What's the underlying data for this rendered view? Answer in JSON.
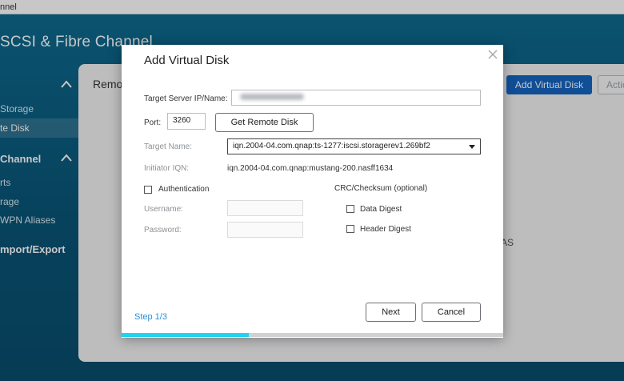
{
  "window": {
    "title_fragment": "nnel"
  },
  "app": {
    "title_fragment": "SCSI & Fibre Channel"
  },
  "sidebar": {
    "groups": [
      {
        "label": "",
        "top": 0
      },
      {
        "label": "Channel"
      }
    ],
    "items": [
      {
        "label": "Storage"
      },
      {
        "label": "te Disk"
      },
      {
        "label": "rts"
      },
      {
        "label": "rage"
      },
      {
        "label": "WPN Aliases"
      },
      {
        "label": "mport/Export"
      }
    ]
  },
  "panel": {
    "title_fragment": "Remo",
    "add_virtual_disk_label": "Add Virtual Disk",
    "action_fragment": "Actio",
    "text_fragment": "AS"
  },
  "dialog": {
    "title": "Add Virtual Disk",
    "target_ip_label": "Target Server IP/Name:",
    "target_ip_value": "",
    "port_label": "Port:",
    "port_value": "3260",
    "get_remote_disk_label": "Get Remote Disk",
    "target_name_label": "Target Name:",
    "target_name_value": "iqn.2004-04.com.qnap:ts-1277:iscsi.storagerev1.269bf2",
    "initiator_label": "Initiator IQN:",
    "initiator_value": "iqn.2004-04.com.qnap:mustang-200.nasff1634",
    "authentication_label": "Authentication",
    "username_label": "Username:",
    "password_label": "Password:",
    "crc_label": "CRC/Checksum (optional)",
    "data_digest_label": "Data Digest",
    "header_digest_label": "Header Digest",
    "step_label": "Step 1/3",
    "next_label": "Next",
    "cancel_label": "Cancel",
    "progress_fraction": 0.333
  },
  "colors": {
    "primary": "#1565c0",
    "progress": "#22d3f0",
    "step": "#2a8fd6"
  }
}
